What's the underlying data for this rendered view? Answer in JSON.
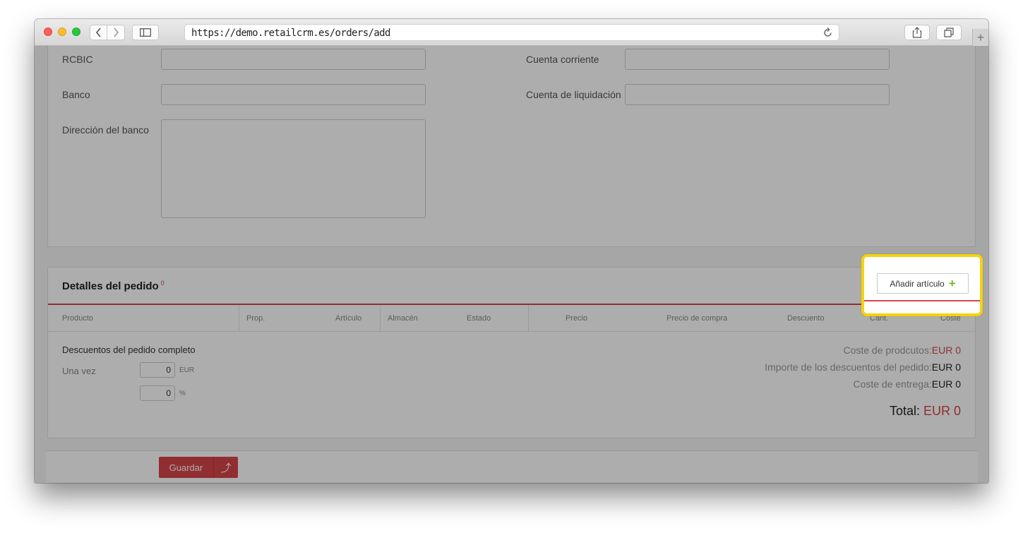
{
  "browser": {
    "url": "https://demo.retailcrm.es/orders/add"
  },
  "bank_form": {
    "rcbic_label": "RCBIC",
    "bank_label": "Banco",
    "bank_address_label": "Dirección del banco",
    "current_account_label": "Cuenta corriente",
    "settlement_account_label": "Cuenta de liquidación"
  },
  "order_details": {
    "title": "Detalles del pedido",
    "count": "0",
    "add_item_label": "Añadir artículo",
    "columns": [
      "Producto",
      "Prop.",
      "Artículo",
      "Almacén",
      "Estado",
      "Precio",
      "Precio de compra",
      "Descuento",
      "Cant.",
      "Coste"
    ],
    "discount": {
      "title": "Descuentos del pedido completo",
      "once_label": "Una vez",
      "amount_value": "0",
      "amount_unit": "EUR",
      "percent_value": "0",
      "percent_unit": "%"
    },
    "summary": {
      "products_cost_label": "Coste de prodcutos:",
      "products_cost_value": "EUR 0",
      "discount_amount_label": "Importe de los descuentos del pedido:",
      "discount_amount_value": "EUR 0",
      "delivery_cost_label": "Coste de entrega:",
      "delivery_cost_value": "EUR 0",
      "total_label": "Total:",
      "total_value": "EUR 0"
    }
  },
  "footer": {
    "save_label": "Guardar",
    "save_more_icon": "⤴"
  },
  "colors": {
    "accent_red": "#d4454a",
    "highlight_yellow": "#f5d20a",
    "plus_green": "#6dbb2c"
  }
}
